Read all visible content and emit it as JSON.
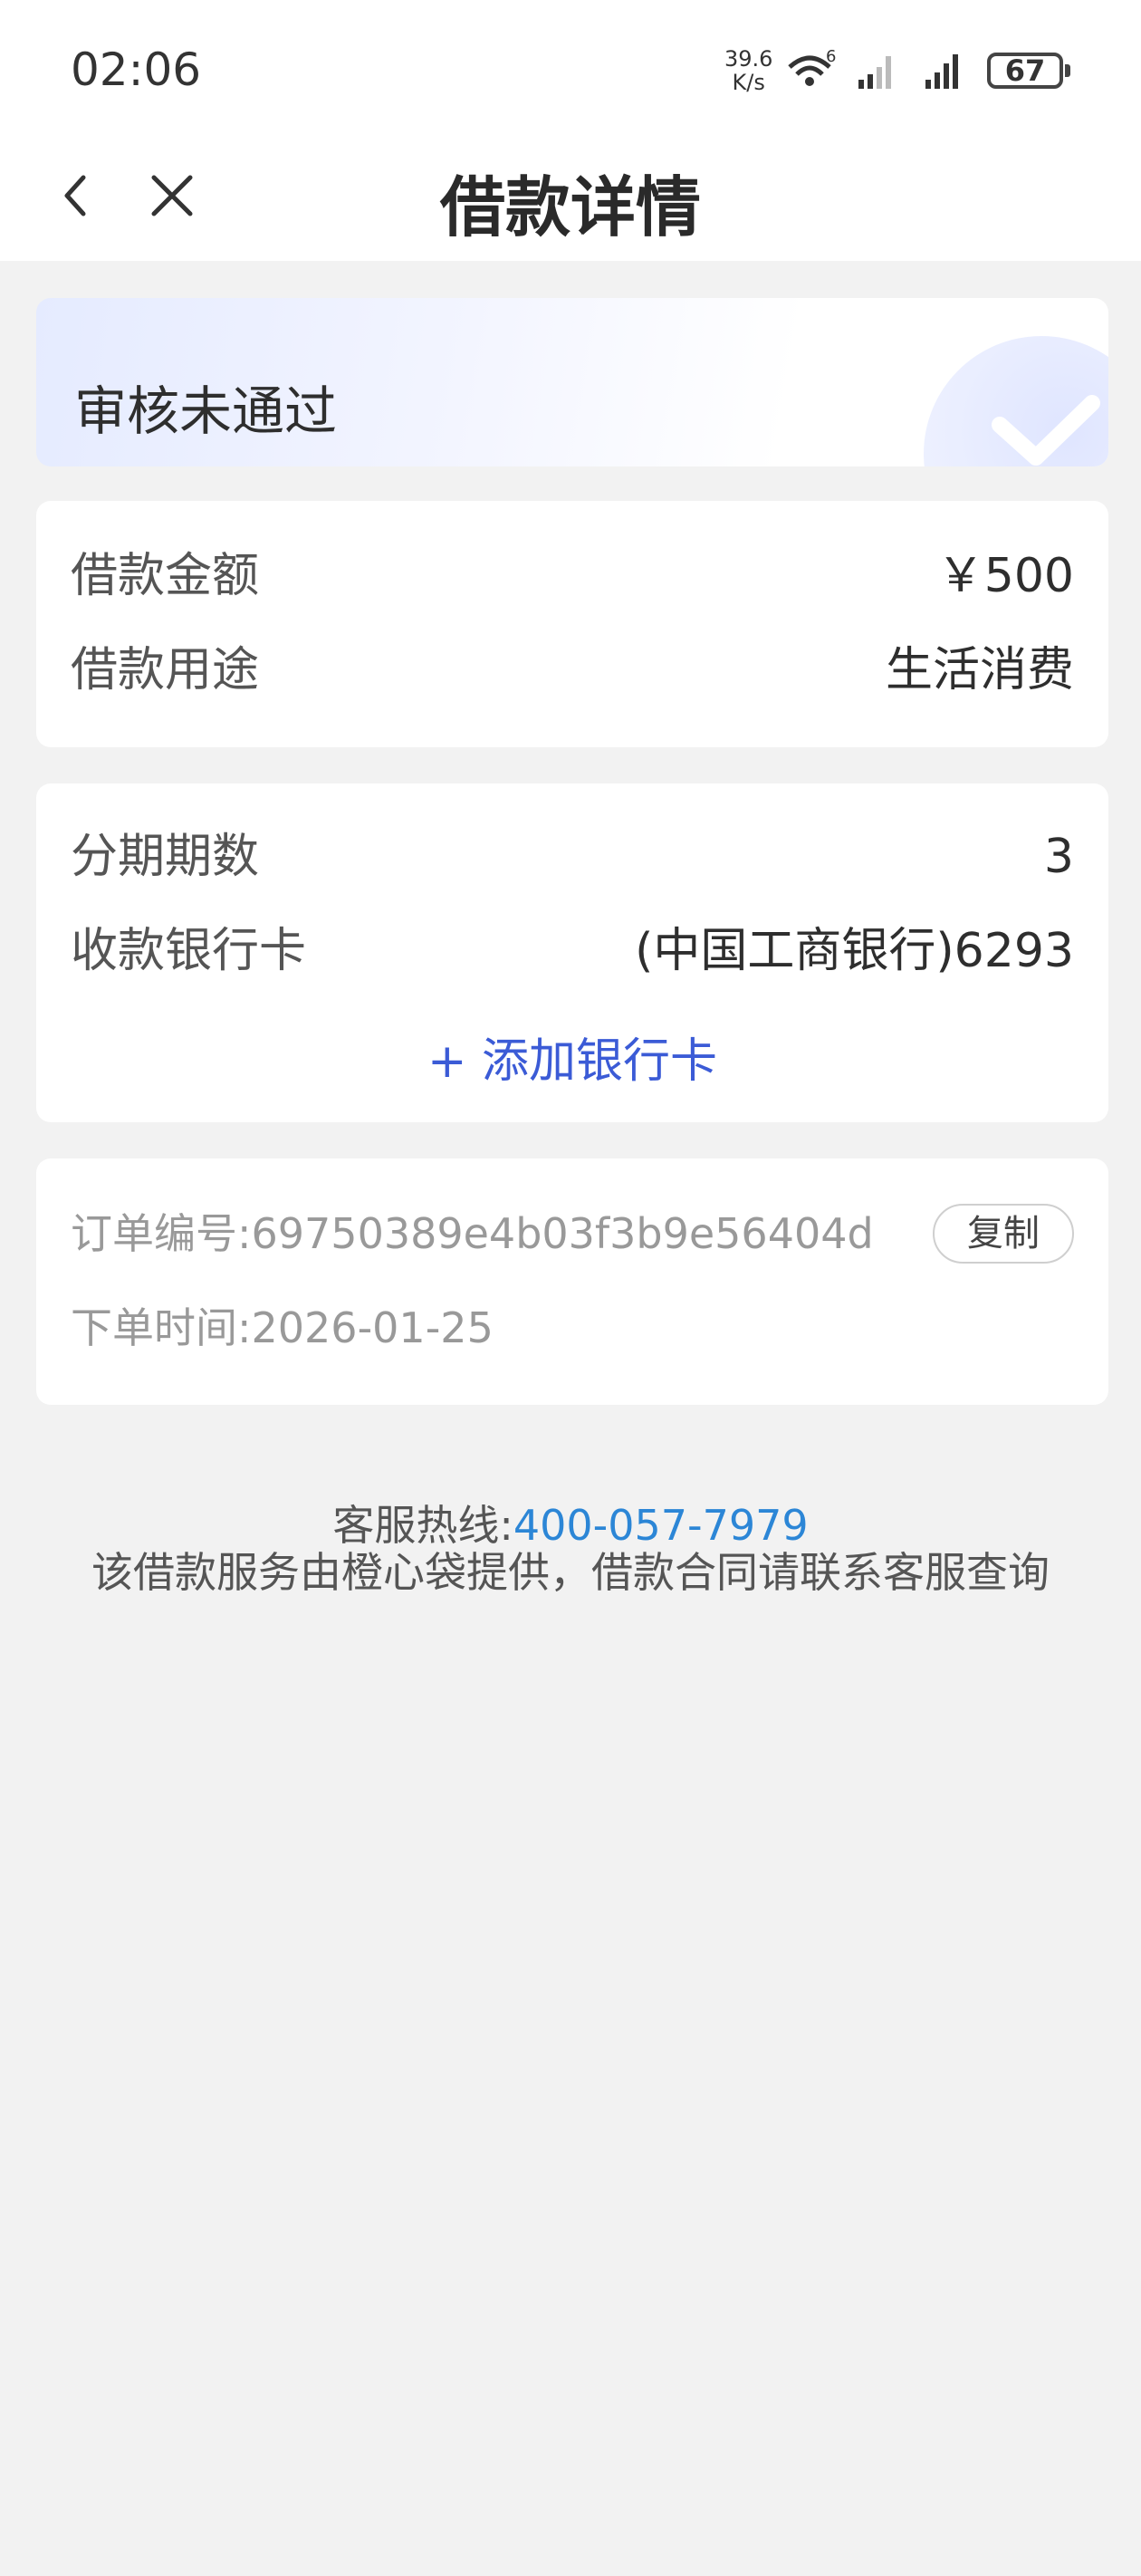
{
  "status_bar": {
    "time": "02:06",
    "net_speed_value": "39.6",
    "net_speed_unit": "K/s",
    "battery": "67"
  },
  "nav": {
    "title": "借款详情",
    "back_icon": "chevron-left-icon",
    "close_icon": "close-icon"
  },
  "status_card": {
    "status": "审核未通过",
    "badge_icon": "checkmark-icon"
  },
  "loan_info": {
    "amount_label": "借款金额",
    "amount_value": "￥500",
    "purpose_label": "借款用途",
    "purpose_value": "生活消费"
  },
  "installment": {
    "periods_label": "分期期数",
    "periods_value": "3",
    "bank_label": "收款银行卡",
    "bank_value": "(中国工商银行)6293",
    "add_card_label": "+ 添加银行卡"
  },
  "order": {
    "number_label": "订单编号:",
    "number_value": "69750389e4b03f3b9e56404d",
    "copy_label": "复制",
    "time_label": "下单时间:",
    "time_value": "2026-01-25"
  },
  "footer": {
    "hotline_label": "客服热线:",
    "hotline_number": "400-057-7979",
    "notice": "该借款服务由橙心袋提供，借款合同请联系客服查询"
  },
  "colors": {
    "accent_blue": "#3b5bd6",
    "link_blue": "#2c86d6",
    "page_bg": "#f2f2f2"
  }
}
